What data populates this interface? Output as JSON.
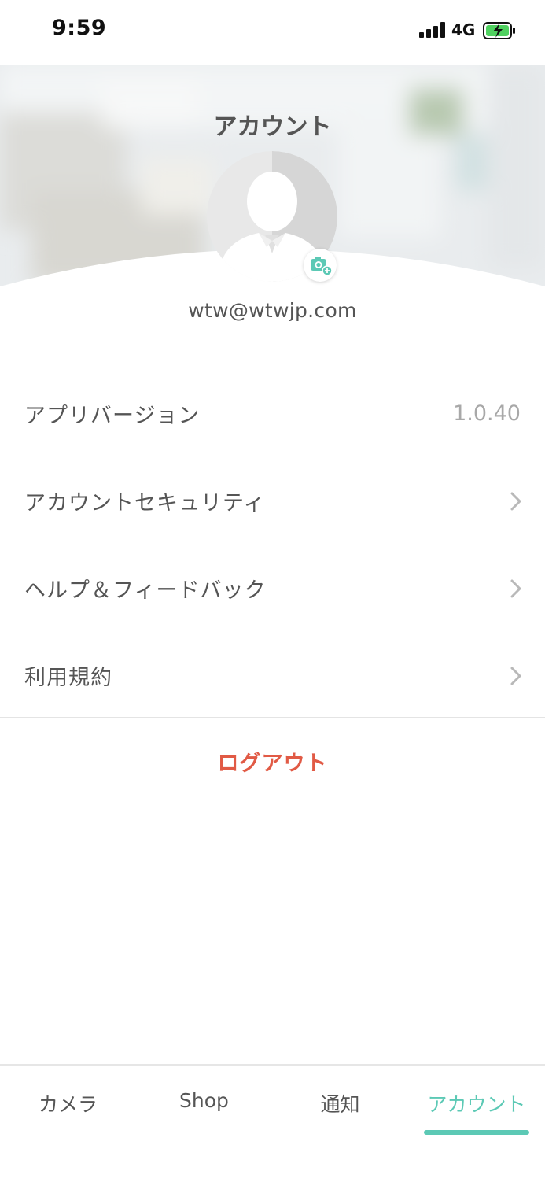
{
  "status_bar": {
    "time": "9:59",
    "network": "4G",
    "icons": [
      "signal-icon",
      "battery-charging-icon"
    ]
  },
  "header": {
    "title": "アカウント",
    "email": "wtw@wtwjp.com",
    "avatar_icon": "default-avatar-icon",
    "badge_icon": "camera-add-icon"
  },
  "menu": {
    "items": [
      {
        "label": "アプリバージョン",
        "value": "1.0.40"
      },
      {
        "label": "アカウントセキュリティ",
        "icon": "chevron-right-icon"
      },
      {
        "label": "ヘルプ＆フィードバック",
        "icon": "chevron-right-icon"
      },
      {
        "label": "利用規約",
        "icon": "chevron-right-icon"
      }
    ],
    "logout_label": "ログアウト"
  },
  "tabbar": {
    "tabs": [
      {
        "label": "カメラ"
      },
      {
        "label": "Shop"
      },
      {
        "label": "通知"
      },
      {
        "label": "アカウント",
        "active": true
      }
    ]
  },
  "colors": {
    "accent": "#5cc9b5",
    "logout": "#e15a45",
    "text": "#555555",
    "muted": "#a8a8a8"
  }
}
